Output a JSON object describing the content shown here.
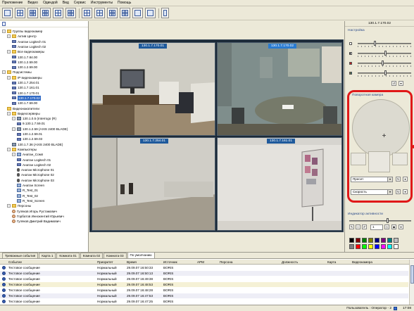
{
  "menu": [
    "Приложение",
    "Видео",
    "Одиндой",
    "Вид",
    "Сервис",
    "Инструменты",
    "Помощь"
  ],
  "tree": {
    "items": [
      {
        "label": "Группы видеокамер",
        "level": 0,
        "icon": "folder",
        "expanded": true
      },
      {
        "label": "Актив Центр",
        "level": 1,
        "icon": "folder",
        "expanded": true
      },
      {
        "label": "Анатан Logitech 01",
        "level": 2,
        "icon": "cam"
      },
      {
        "label": "Анатан Logitech 02",
        "level": 2,
        "icon": "cam"
      },
      {
        "label": "Все видеокамеры",
        "level": 1,
        "icon": "folder",
        "expanded": true
      },
      {
        "label": "130.1.7.84.00",
        "level": 2,
        "icon": "cam"
      },
      {
        "label": "130.1.2.59.00",
        "level": 2,
        "icon": "cam"
      },
      {
        "label": "130.1.2.59.00",
        "level": 2,
        "icon": "cam"
      },
      {
        "label": "Подсистемы",
        "level": 0,
        "icon": "folder",
        "expanded": true
      },
      {
        "label": "IP видеокамеры",
        "level": 1,
        "icon": "folder",
        "expanded": true
      },
      {
        "label": "130.1.7.254.01",
        "level": 2,
        "icon": "cam"
      },
      {
        "label": "130.1.7.161.01",
        "level": 2,
        "icon": "cam"
      },
      {
        "label": "130.1.7.170.01",
        "level": 2,
        "icon": "cam"
      },
      {
        "label": "130.1.7.170.02",
        "level": 2,
        "icon": "cam",
        "selected": true
      },
      {
        "label": "130.1.7.59.00",
        "level": 2,
        "icon": "cam"
      },
      {
        "label": "Видеонакопители",
        "level": 1,
        "icon": "folder"
      },
      {
        "label": "Видеосерверы",
        "level": 1,
        "icon": "folder",
        "expanded": true
      },
      {
        "label": "130.1.0.5 (Interrogo (R)",
        "level": 2,
        "icon": "server",
        "expanded": true
      },
      {
        "label": "9.130.1.7.59.01",
        "level": 3,
        "icon": "cam"
      },
      {
        "label": "130.1.2.59 (AXIS 2400 BLADE)",
        "level": 2,
        "icon": "server",
        "expanded": true
      },
      {
        "label": "130.1.2.59.01",
        "level": 3,
        "icon": "cam"
      },
      {
        "label": "130.1.2.59.03",
        "level": 3,
        "icon": "cam"
      },
      {
        "label": "130.1.7.36 (AXIS 2400 BLADE)",
        "level": 2,
        "icon": "server"
      },
      {
        "label": "Компьютеры",
        "level": 1,
        "icon": "folder",
        "expanded": true
      },
      {
        "label": "Анатан_Сомп",
        "level": 2,
        "icon": "pc",
        "expanded": true
      },
      {
        "label": "Анатан Logitech 01",
        "level": 3,
        "icon": "cam"
      },
      {
        "label": "Анатан Logitech 02",
        "level": 3,
        "icon": "cam"
      },
      {
        "label": "Анатан Microphone 01",
        "level": 3,
        "icon": "mic"
      },
      {
        "label": "Анатан Microphone 02",
        "level": 3,
        "icon": "mic"
      },
      {
        "label": "Анатан Microphone 03",
        "level": 3,
        "icon": "mic"
      },
      {
        "label": "Анатан Screen",
        "level": 3,
        "icon": "pc"
      },
      {
        "label": "R_Test_01",
        "level": 3,
        "icon": "pc"
      },
      {
        "label": "R_Test_02",
        "level": 3,
        "icon": "pc"
      },
      {
        "label": "R_Test_Screen",
        "level": 3,
        "icon": "pc"
      },
      {
        "label": "Персоны",
        "level": 1,
        "icon": "folder",
        "expanded": true
      },
      {
        "label": "Гуляков Игорь Рустамович",
        "level": 2,
        "icon": "person"
      },
      {
        "label": "Горбатов Иннокентий Юрьевич",
        "level": 2,
        "icon": "person"
      },
      {
        "label": "Гуляков Дмитрий Вадимович",
        "level": 2,
        "icon": "person"
      }
    ]
  },
  "video": {
    "cells": [
      {
        "label": "130.1.7.170.01"
      },
      {
        "label": "130.1.7.170.02"
      },
      {
        "label": "130.1.7.254.01"
      },
      {
        "label": "130.1.7.161.01"
      }
    ]
  },
  "right_panel": {
    "camera_title": "130.1.7.170.02",
    "settings_title": "Настройка",
    "ptz_title": "Поворотная камера",
    "preset_value": "Пресет",
    "speed_value": "Скорость",
    "indicator_title": "Индикатор активности",
    "indicator_value": "1",
    "sliders": [
      {
        "name": "brightness",
        "level": 0.3
      },
      {
        "name": "contrast",
        "level": 0.5
      },
      {
        "name": "saturation",
        "level": 0.45
      },
      {
        "name": "hue",
        "level": 0.5
      }
    ],
    "palette": [
      "#000000",
      "#7f0000",
      "#007f00",
      "#7f7f00",
      "#00007f",
      "#7f007f",
      "#007f7f",
      "#c0c0c0",
      "#808080",
      "#ff0000",
      "#00ff00",
      "#ffff00",
      "#0000ff",
      "#ff00ff",
      "#00ffff",
      "#ffffff"
    ]
  },
  "events": {
    "tabs": [
      {
        "label": "Тревожные события",
        "active": false
      },
      {
        "label": "Карта 1",
        "active": false
      },
      {
        "label": "Комната 01",
        "active": false
      },
      {
        "label": "Комната 02",
        "active": false
      },
      {
        "label": "Комната 03",
        "active": false
      },
      {
        "label": "По умолчанию",
        "active": true
      }
    ],
    "columns": [
      "Событие",
      "Приоритет",
      "Время",
      "Источник",
      "АРМ",
      "Персона",
      "Должность",
      "Карта",
      "Видеокамера"
    ],
    "rows": [
      {
        "event": "Тестовое сообщение",
        "priority": "Нормальный",
        "time": "29.09.07 16:50:33",
        "source": "BORIS"
      },
      {
        "event": "Тестовое сообщение",
        "priority": "Нормальный",
        "time": "29.09.07 16:50:13",
        "source": "BORIS"
      },
      {
        "event": "Тестовое сообщение",
        "priority": "Нормальный",
        "time": "29.09.07 16:49:38",
        "source": "BORIS"
      },
      {
        "event": "Тестовое сообщение",
        "priority": "Нормальный",
        "time": "29.09.07 16:48:53",
        "source": "BORIS"
      },
      {
        "event": "Тестовое сообщение",
        "priority": "Нормальный",
        "time": "29.09.07 16:48:28",
        "source": "BORIS"
      },
      {
        "event": "Тестовое сообщение",
        "priority": "Нормальный",
        "time": "29.09.07 16:47:53",
        "source": "BORIS"
      },
      {
        "event": "Тестовое сообщение",
        "priority": "Нормальный",
        "time": "29.09.07 16:47:25",
        "source": "BORIS"
      }
    ]
  },
  "status": {
    "user": "Пользователь : Оператор - 2",
    "time": "17:08"
  }
}
